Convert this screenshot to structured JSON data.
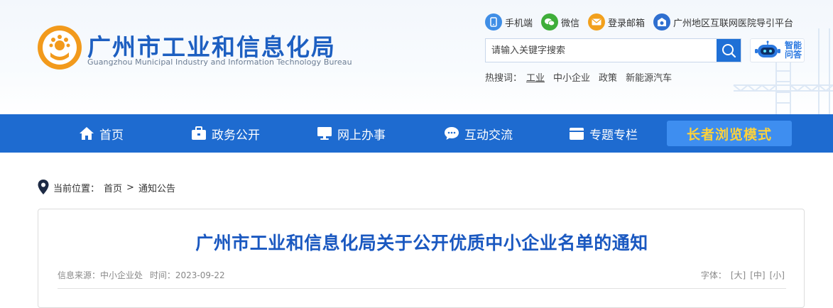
{
  "header": {
    "title": "广州市工业和信息化局",
    "subtitle": "Guangzhou Municipal Industry and Information Technology Bureau",
    "top_links": [
      {
        "label": "手机端",
        "icon": "mobile-icon",
        "color": "#3f8ee6"
      },
      {
        "label": "微信",
        "icon": "wechat-icon",
        "color": "#3fae3a"
      },
      {
        "label": "登录邮箱",
        "icon": "mail-icon",
        "color": "#f2a01c"
      },
      {
        "label": "广州地区互联网医院导引平台",
        "icon": "hospital-icon",
        "color": "#2f6fd0"
      }
    ],
    "search": {
      "placeholder": "请输入关键字搜索"
    },
    "ai_assistant": {
      "label": "智能问答"
    },
    "hot_search": {
      "label": "热搜词：",
      "keywords": [
        "工业",
        "中小企业",
        "政策",
        "新能源汽车"
      ]
    }
  },
  "nav": {
    "items": [
      {
        "label": "首页",
        "icon": "home-icon"
      },
      {
        "label": "政务公开",
        "icon": "briefcase-icon"
      },
      {
        "label": "网上办事",
        "icon": "monitor-icon"
      },
      {
        "label": "互动交流",
        "icon": "chat-icon"
      },
      {
        "label": "专题专栏",
        "icon": "folder-icon"
      }
    ],
    "elder_mode": "长者浏览模式",
    "colors": {
      "bar": "#1e6bd0",
      "elder_bg": "#3e8ef0",
      "elder_text": "#ffd23a"
    }
  },
  "breadcrumb": {
    "label": "当前位置：",
    "items": [
      "首页",
      "通知公告"
    ],
    "separator": ">"
  },
  "article": {
    "title": "广州市工业和信息化局关于公开优质中小企业名单的通知",
    "source_label": "信息来源：",
    "source": "中小企业处",
    "time_label": "时间：",
    "time": "2023-09-22",
    "font_label": "字体：",
    "font_sizes": [
      "[大]",
      "[中]",
      "[小]"
    ]
  },
  "colors": {
    "brand": "#1d5fc1",
    "accent": "#f29a1c"
  }
}
